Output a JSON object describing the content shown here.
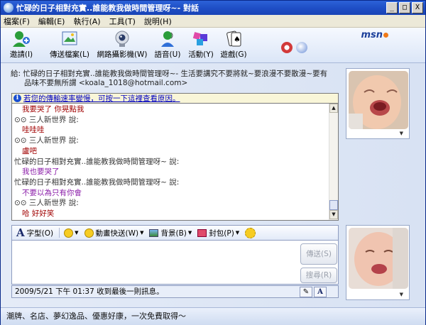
{
  "window": {
    "title": "忙碌的日子相對充實..誰能教我做時間管理呀~- 對話",
    "controls": [
      "_",
      "□",
      "X"
    ]
  },
  "menu": [
    "檔案(F)",
    "編輯(E)",
    "執行(A)",
    "工具(T)",
    "說明(H)"
  ],
  "toolbar": {
    "items": [
      {
        "label": "邀請(I)",
        "icon": "invite-icon"
      },
      {
        "label": "傳送檔案(L)",
        "icon": "send-file-icon"
      },
      {
        "label": "網路攝影機(W)",
        "icon": "webcam-icon"
      },
      {
        "label": "語音(U)",
        "icon": "voice-icon"
      },
      {
        "label": "活動(Y)",
        "icon": "activities-icon"
      },
      {
        "label": "遊戲(G)",
        "icon": "games-icon"
      }
    ],
    "brand": "msn"
  },
  "to": {
    "prefix": "給:",
    "line1": "忙碌的日子相對充實..誰能教我做時間管理呀~- 生活要講究不要將就~要浪漫不要散漫~要有",
    "line2": "品味不要無所謂 <koala_1018@hotmail.com>"
  },
  "banner": {
    "text": "若您的傳輸速率變慢，可按一下這裡查看原因。"
  },
  "chat": {
    "lines": [
      {
        "kind": "msg",
        "text": "我要哭了 你晃點我",
        "color": "#a00000"
      },
      {
        "kind": "name",
        "text": "⊙⊙ 三人新世界 說:"
      },
      {
        "kind": "msg",
        "text": "哇哇哇",
        "color": "#a00000"
      },
      {
        "kind": "name",
        "text": "⊙⊙ 三人新世界 說:"
      },
      {
        "kind": "msg",
        "text": "盧吧",
        "color": "#a00000"
      },
      {
        "kind": "name",
        "text": "忙碌的日子相對充實..誰能教我做時間管理呀~ 說:"
      },
      {
        "kind": "msg",
        "text": "我也要哭了",
        "color": "#8a1ca8"
      },
      {
        "kind": "name",
        "text": "忙碌的日子相對充實..誰能教我做時間管理呀~ 說:"
      },
      {
        "kind": "msg",
        "text": "不要以為只有你會",
        "color": "#8a1ca8"
      },
      {
        "kind": "name",
        "text": "⊙⊙ 三人新世界 說:"
      },
      {
        "kind": "msg",
        "text": "哈 好好笑",
        "color": "#a00000"
      }
    ]
  },
  "format_bar": {
    "font": "字型(O)",
    "emoticon_icon": "smiley-icon",
    "wink": "動畫快送(W)",
    "background": "背景(B)",
    "gift": "封包(P)",
    "nudge_icon": "nudge-icon"
  },
  "compose": {
    "value": ""
  },
  "buttons": {
    "send": "傳送(S)",
    "search": "搜尋(R)"
  },
  "status": {
    "last_message": "2009/5/21 下午 01:37 收到最後一則訊息。"
  },
  "footer": {
    "ad": "潮牌、名店、夢幻逸品、優惠好康，一次免費取得～"
  }
}
